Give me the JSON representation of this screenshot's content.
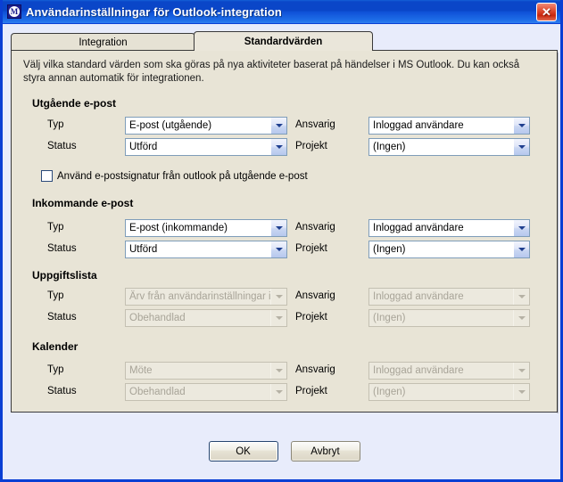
{
  "window": {
    "title": "Användarinställningar för Outlook-integration",
    "app_icon": "outlook-integration-icon",
    "app_icon_letter": "M",
    "close_label": "✕",
    "titlebar_color": "#0a46c8",
    "panel_color": "#e8e4d6",
    "dialog_color": "#e8ecfb"
  },
  "tabs": [
    {
      "label": "Integration",
      "active": false
    },
    {
      "label": "Standardvärden",
      "active": true
    }
  ],
  "intro_text": "Välj vilka standard värden som ska göras på nya aktiviteter baserat på händelser i MS Outlook. Du kan också styra annan automatik för integrationen.",
  "labels": {
    "typ": "Typ",
    "status": "Status",
    "ansvarig": "Ansvarig",
    "projekt": "Projekt"
  },
  "sections": [
    {
      "title": "Utgående e-post",
      "disabled": false,
      "typ": "E-post (utgående)",
      "status": "Utförd",
      "ansvarig": "Inloggad användare",
      "projekt": "(Ingen)"
    },
    {
      "title": "Inkommande e-post",
      "disabled": false,
      "typ": "E-post (inkommande)",
      "status": "Utförd",
      "ansvarig": "Inloggad användare",
      "projekt": "(Ingen)"
    },
    {
      "title": "Uppgiftslista",
      "disabled": true,
      "typ": "Ärv från användarinställningar i a",
      "status": "Obehandlad",
      "ansvarig": "Inloggad användare",
      "projekt": "(Ingen)"
    },
    {
      "title": "Kalender",
      "disabled": true,
      "typ": "Möte",
      "status": "Obehandlad",
      "ansvarig": "Inloggad användare",
      "projekt": "(Ingen)"
    }
  ],
  "signature_checkbox": {
    "label": "Använd e-postsignatur från outlook på utgående e-post",
    "checked": false
  },
  "buttons": {
    "ok": "OK",
    "cancel": "Avbryt"
  }
}
